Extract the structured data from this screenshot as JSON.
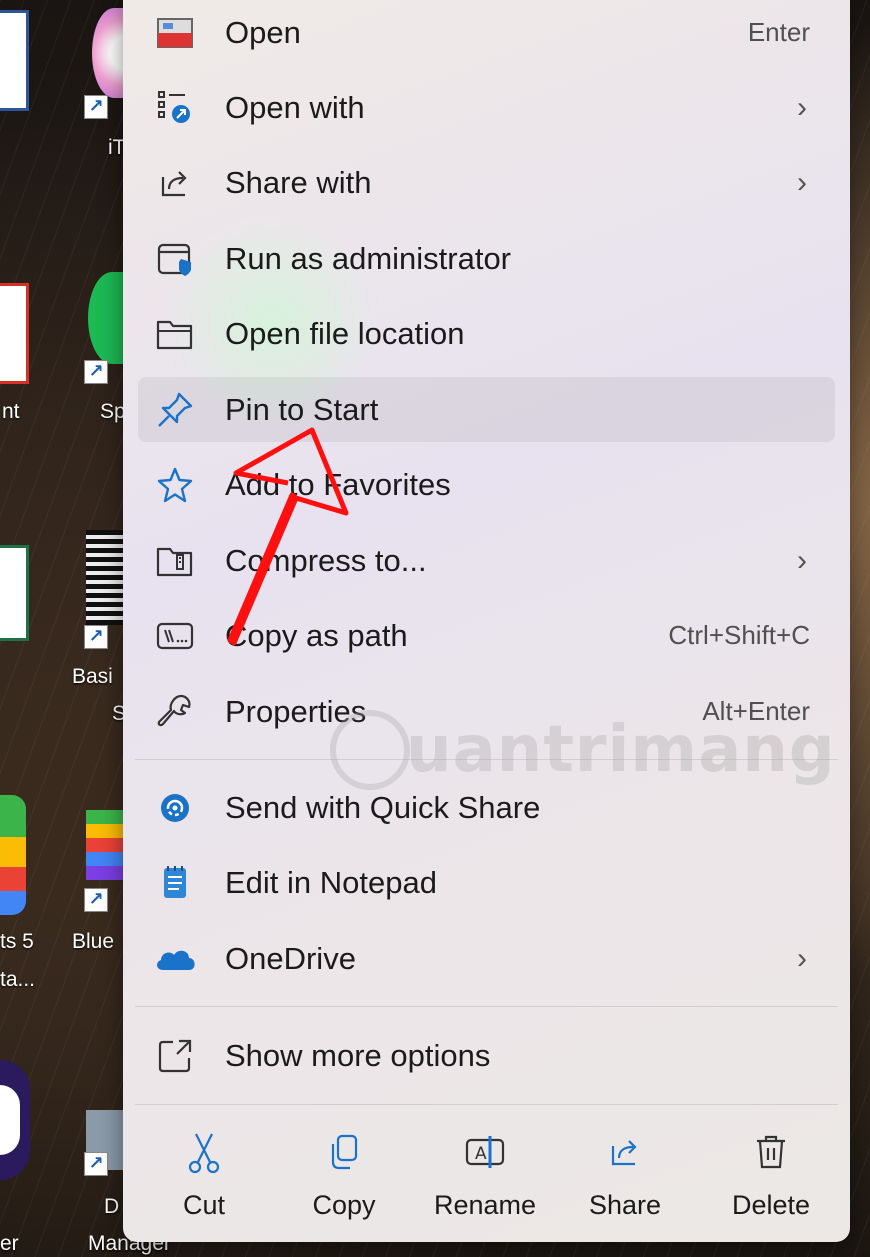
{
  "desktop": {
    "labels": [
      "iT",
      "nt",
      "Sp",
      "Basi",
      "S",
      "ts 5",
      "Blue",
      "ta...",
      "er",
      "D",
      "Manager"
    ]
  },
  "menu": {
    "items": [
      {
        "label": "Open",
        "shortcut": "Enter",
        "icon": "toolbox-icon"
      },
      {
        "label": "Open with",
        "submenu": "›",
        "icon": "open-with-icon"
      },
      {
        "label": "Share with",
        "submenu": "›",
        "icon": "share-icon"
      },
      {
        "label": "Run as administrator",
        "icon": "shield-window-icon"
      },
      {
        "label": "Open file location",
        "icon": "folder-icon"
      },
      {
        "label": "Pin to Start",
        "icon": "pin-icon"
      },
      {
        "label": "Add to Favorites",
        "icon": "star-icon"
      },
      {
        "label": "Compress to...",
        "submenu": "›",
        "icon": "zip-folder-icon"
      },
      {
        "label": "Copy as path",
        "shortcut": "Ctrl+Shift+C",
        "icon": "path-icon"
      },
      {
        "label": "Properties",
        "shortcut": "Alt+Enter",
        "icon": "wrench-icon"
      },
      {
        "label": "Send with Quick Share",
        "icon": "quick-share-icon"
      },
      {
        "label": "Edit in Notepad",
        "icon": "notepad-icon"
      },
      {
        "label": "OneDrive",
        "submenu": "›",
        "icon": "cloud-icon"
      },
      {
        "label": "Show more options",
        "icon": "expand-icon"
      }
    ],
    "actions": [
      {
        "label": "Cut",
        "icon": "scissors-icon"
      },
      {
        "label": "Copy",
        "icon": "copy-icon"
      },
      {
        "label": "Rename",
        "icon": "rename-icon"
      },
      {
        "label": "Share",
        "icon": "share-icon"
      },
      {
        "label": "Delete",
        "icon": "trash-icon"
      }
    ],
    "accent_color": "#1a73c8"
  },
  "watermark": {
    "text": "uantrimang"
  }
}
